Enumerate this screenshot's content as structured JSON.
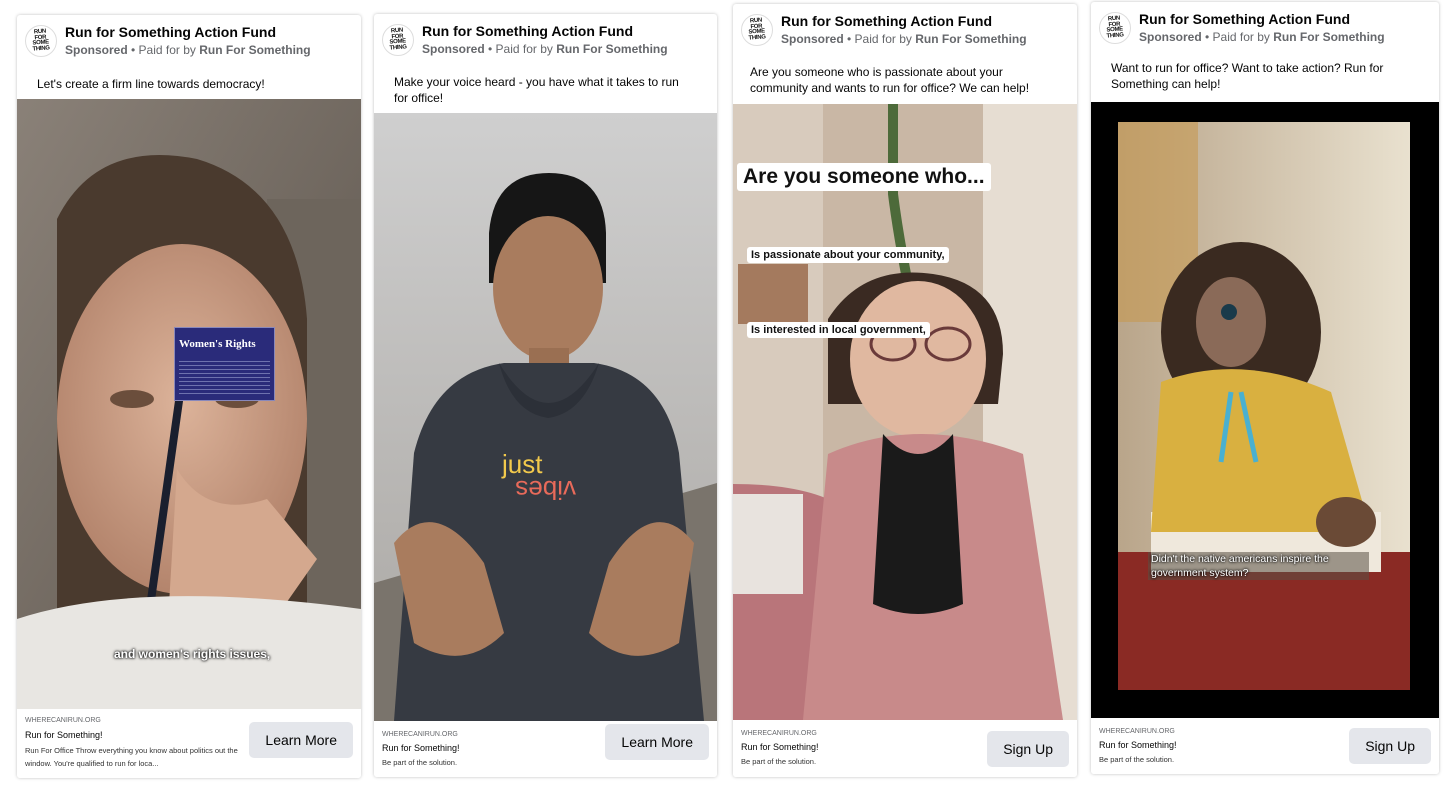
{
  "cards": [
    {
      "page_name": "Run for Something Action Fund",
      "sponsored": "Sponsored",
      "paid_for_prefix": "Paid for by",
      "paid_for_name": "Run For Something",
      "caption": "Let's create a firm line towards democracy!",
      "overlay_card_title": "Women's Rights",
      "subtitle": "and women's rights issues,",
      "domain": "WHERECANIRUN.ORG",
      "link_title": "Run for Something!",
      "link_description": "Run For Office Throw everything you know about politics out the window. You're qualified to run for loca...",
      "cta": "Learn More"
    },
    {
      "page_name": "Run for Something Action Fund",
      "sponsored": "Sponsored",
      "paid_for_prefix": "Paid for by",
      "paid_for_name": "Run For Something",
      "caption": "Make your voice heard - you have what it takes to run for office!",
      "domain": "WHERECANIRUN.ORG",
      "link_title": "Run for Something!",
      "link_description": "Be part of the solution.",
      "cta": "Learn More"
    },
    {
      "page_name": "Run for Something Action Fund",
      "sponsored": "Sponsored",
      "paid_for_prefix": "Paid for by",
      "paid_for_name": "Run For Something",
      "caption": "Are you someone who is passionate about your community and wants to run for office? We can help!",
      "overlay_title": "Are you someone who...",
      "overlay_line1": "Is passionate about your community,",
      "overlay_line2": "Is interested in local government,",
      "domain": "WHERECANIRUN.ORG",
      "link_title": "Run for Something!",
      "link_description": "Be part of the solution.",
      "cta": "Sign Up"
    },
    {
      "page_name": "Run for Something Action Fund",
      "sponsored": "Sponsored",
      "paid_for_prefix": "Paid for by",
      "paid_for_name": "Run For Something",
      "caption": "Want to run for office? Want to take action? Run for Something can help!",
      "subtitle": "Didn't the native americans inspire the government system?",
      "domain": "WHERECANIRUN.ORG",
      "link_title": "Run for Something!",
      "link_description": "Be part of the solution.",
      "cta": "Sign Up"
    }
  ],
  "logo_text": "RUN FOR SOMETHING",
  "colors": {
    "cta_bg": "#e4e6eb",
    "meta": "#65676b"
  }
}
